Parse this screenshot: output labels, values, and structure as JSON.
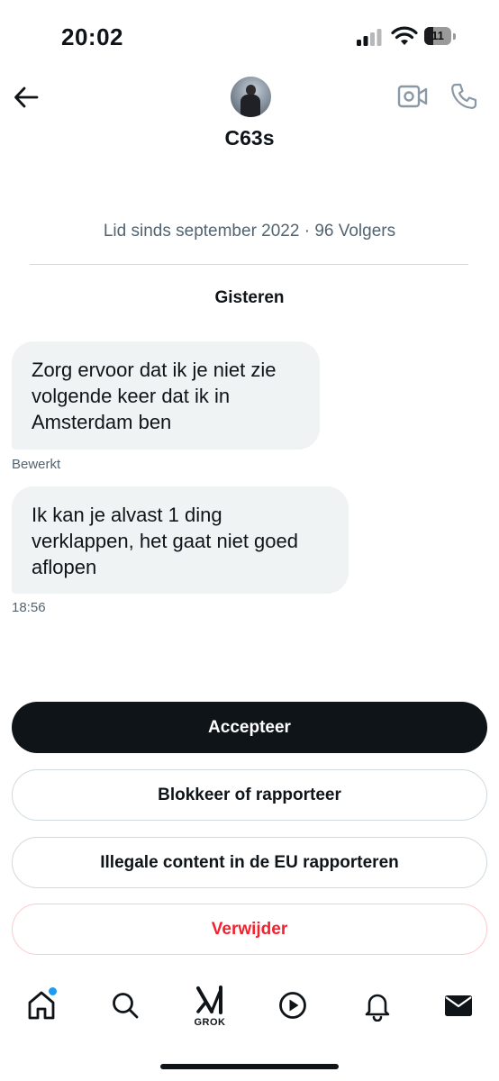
{
  "status_bar": {
    "time": "20:02",
    "battery": "11"
  },
  "header": {
    "username": "C63s",
    "back_icon": "arrow-left-icon",
    "video_icon": "video-camera-icon",
    "phone_icon": "phone-icon"
  },
  "profile_meta": "Lid sinds september 2022 · 96 Volgers",
  "day_label": "Gisteren",
  "messages": [
    {
      "text": "Zorg ervoor dat ik je niet zie volgende keer dat ik in Amsterdam ben",
      "meta": "Bewerkt"
    },
    {
      "text": "Ik kan je alvast 1 ding verklappen, het gaat niet goed aflopen",
      "meta": "18:56"
    }
  ],
  "actions": {
    "accept": "Accepteer",
    "block_report": "Blokkeer of rapporteer",
    "report_eu": "Illegale content in de EU rapporteren",
    "delete": "Verwijder"
  },
  "nav": {
    "items": [
      "home-icon",
      "search-icon",
      "grok-icon",
      "play-icon",
      "bell-icon",
      "mail-icon"
    ],
    "grok_label": "GROK"
  },
  "colors": {
    "primary_text": "#0f1419",
    "secondary_text": "#536471",
    "danger": "#f4212e",
    "accent_dot": "#1d9bf0"
  }
}
